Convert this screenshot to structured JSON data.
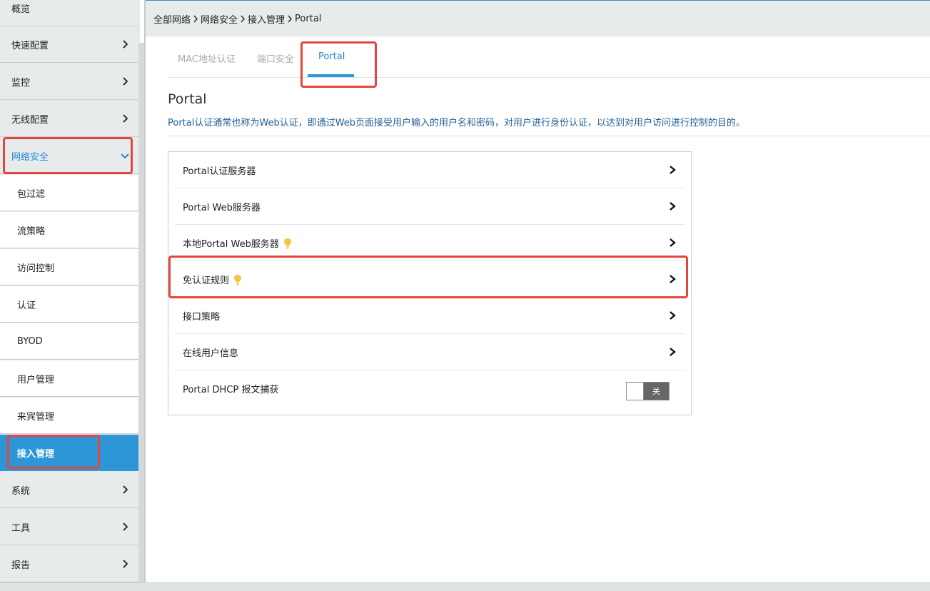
{
  "sidebar": {
    "items": [
      {
        "label": "概览"
      },
      {
        "label": "快速配置"
      },
      {
        "label": "监控"
      },
      {
        "label": "无线配置"
      },
      {
        "label": "网络安全"
      },
      {
        "label": "包过滤"
      },
      {
        "label": "流策略"
      },
      {
        "label": "访问控制"
      },
      {
        "label": "认证"
      },
      {
        "label": "BYOD"
      },
      {
        "label": "用户管理"
      },
      {
        "label": "来宾管理"
      },
      {
        "label": "接入管理"
      },
      {
        "label": "系统"
      },
      {
        "label": "工具"
      },
      {
        "label": "报告"
      }
    ]
  },
  "breadcrumb": [
    "全部网络",
    "网络安全",
    "接入管理",
    "Portal"
  ],
  "tabs": [
    {
      "label": "MAC地址认证"
    },
    {
      "label": "端口安全"
    },
    {
      "label": "Portal"
    }
  ],
  "page": {
    "title": "Portal",
    "description": "Portal认证通常也称为Web认证，即通过Web页面接受用户输入的用户名和密码，对用户进行身份认证，以达到对用户访问进行控制的目的。"
  },
  "settings": {
    "rows": [
      {
        "label": "Portal认证服务器"
      },
      {
        "label": "Portal Web服务器"
      },
      {
        "label": "本地Portal Web服务器"
      },
      {
        "label": "免认证规则"
      },
      {
        "label": "接口策略"
      },
      {
        "label": "在线用户信息"
      },
      {
        "label": "Portal DHCP 报文捕获"
      }
    ],
    "dhcp_toggle_label": "关"
  },
  "colors": {
    "accent": "#2d96d6",
    "highlight": "#e5453f",
    "hint_bulb": "#f5c542"
  },
  "icons": {
    "chevron": "chevron-right-icon",
    "chevron_expanded": "chevron-down-icon",
    "hint": "lightbulb-icon"
  }
}
